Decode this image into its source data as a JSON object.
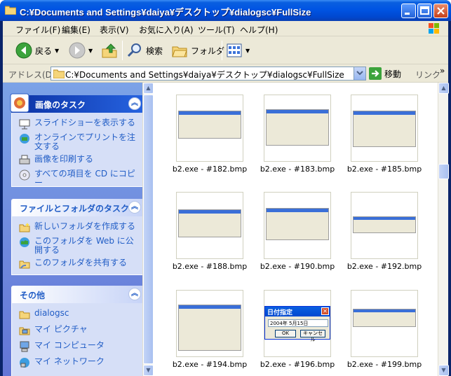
{
  "window": {
    "title": "C:¥Documents and Settings¥daiya¥デスクトップ¥dialogsc¥FullSize"
  },
  "menu": {
    "items": [
      "ファイル(F)",
      "編集(E)",
      "表示(V)",
      "お気に入り(A)",
      "ツール(T)",
      "ヘルプ(H)"
    ]
  },
  "toolbar": {
    "back_label": "戻る",
    "search_label": "検索",
    "folders_label": "フォルダ"
  },
  "address": {
    "label": "アドレス(D)",
    "value": "C:¥Documents and Settings¥daiya¥デスクトップ¥dialogsc¥FullSize",
    "go_label": "移動",
    "links_label": "リンク"
  },
  "tasks": {
    "picture": {
      "title": "画像のタスク",
      "links": [
        "スライドショーを表示する",
        "オンラインでプリントを注文する",
        "画像を印刷する",
        "すべての項目を CD にコピー"
      ]
    },
    "file_folder": {
      "title": "ファイルとフォルダのタスク",
      "links": [
        "新しいフォルダを作成する",
        "このフォルダを Web に公開する",
        "このフォルダを共有する"
      ]
    },
    "other": {
      "title": "その他",
      "links": [
        "dialogsc",
        "マイ ピクチャ",
        "マイ コンピュータ",
        "マイ ネットワーク"
      ]
    }
  },
  "files": [
    {
      "name": "b2.exe - #182.bmp"
    },
    {
      "name": "b2.exe - #183.bmp"
    },
    {
      "name": "b2.exe - #185.bmp"
    },
    {
      "name": "b2.exe - #188.bmp"
    },
    {
      "name": "b2.exe - #190.bmp"
    },
    {
      "name": "b2.exe - #192.bmp"
    },
    {
      "name": "b2.exe - #194.bmp"
    },
    {
      "name": "b2.exe - #196.bmp"
    },
    {
      "name": "b2.exe - #199.bmp"
    }
  ],
  "dialog_preview": {
    "title": "日付指定",
    "date_value": "2004年 5月15日",
    "ok_label": "OK",
    "cancel_label": "キャンセル"
  }
}
